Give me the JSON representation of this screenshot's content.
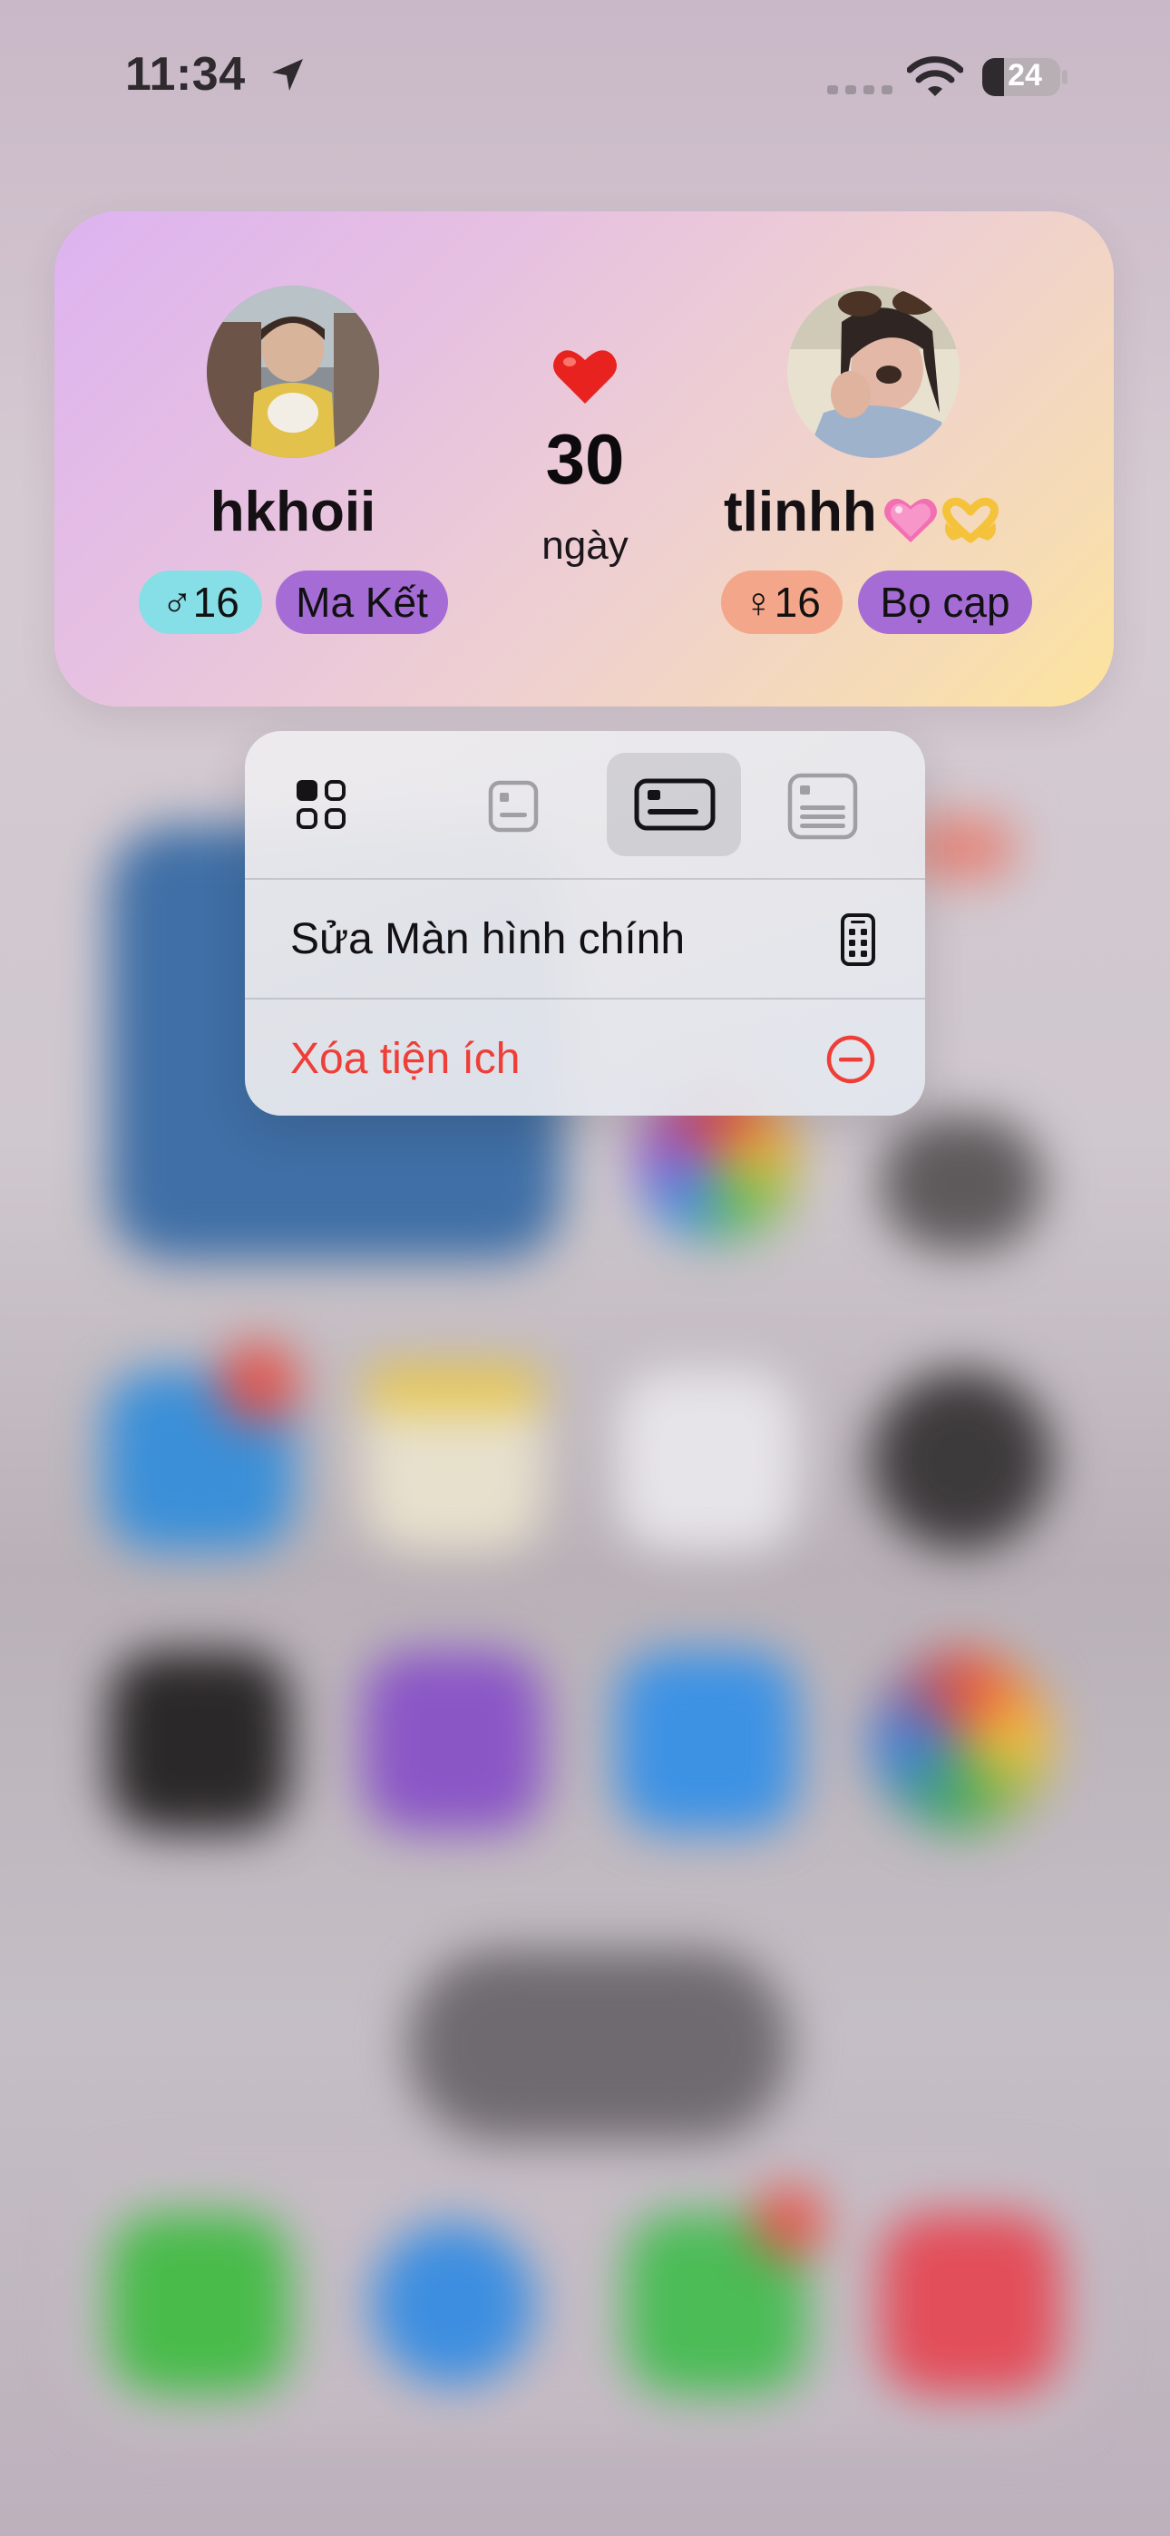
{
  "status_bar": {
    "time": "11:34",
    "battery": "24",
    "icons": [
      "location-arrow-icon",
      "cellular-signal-icon",
      "wifi-icon",
      "battery-icon"
    ]
  },
  "widget": {
    "left_person": {
      "name": "hkhoii",
      "gender_age": "♂16",
      "zodiac": "Ma Kết"
    },
    "right_person": {
      "name": "tlinhh",
      "emojis": [
        "pink-heart-icon",
        "heart-hands-icon"
      ],
      "gender_age": "♀16",
      "zodiac": "Bọ cạp"
    },
    "days_count": "30",
    "days_label": "ngày",
    "icon": "red-heart-icon"
  },
  "context_menu": {
    "size_options": [
      {
        "name": "widget-gallery",
        "icon": "widget-grid-icon",
        "selected": false
      },
      {
        "name": "small",
        "icon": "widget-small-icon",
        "selected": false
      },
      {
        "name": "medium",
        "icon": "widget-medium-icon",
        "selected": true
      },
      {
        "name": "large",
        "icon": "widget-large-icon",
        "selected": false
      }
    ],
    "edit_home_label": "Sửa Màn hình chính",
    "edit_home_icon": "home-screen-icon",
    "remove_widget_label": "Xóa tiện ích",
    "remove_widget_icon": "minus-circle-icon"
  },
  "colors": {
    "destructive": "#ee3e37",
    "male_pill": "#86dfe6",
    "female_pill": "#f3a68a",
    "zodiac_pill": "#a56cd6"
  }
}
